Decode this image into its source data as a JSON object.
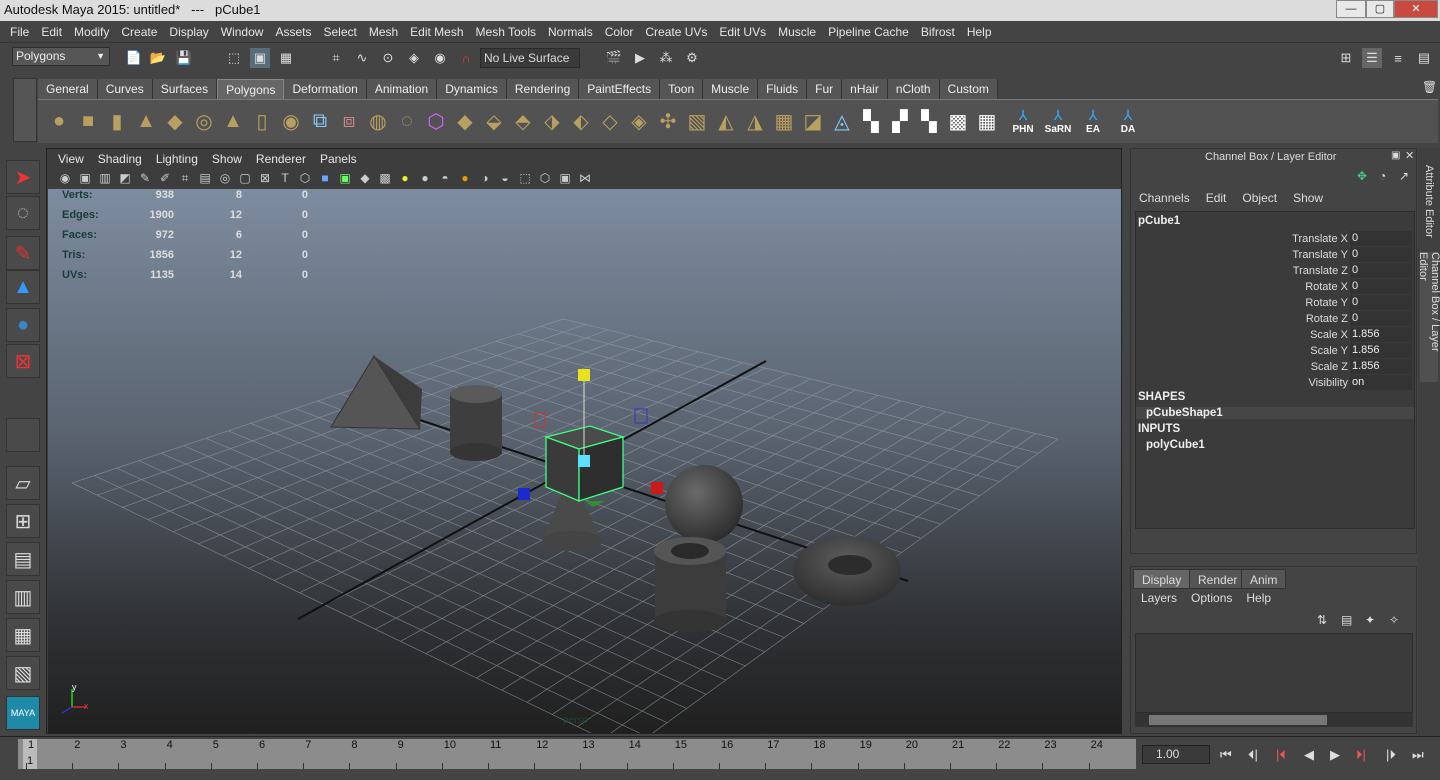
{
  "window": {
    "title": "Autodesk Maya 2015: untitled*   ---   pCube1",
    "controls": [
      "—",
      "▢",
      "✕"
    ]
  },
  "menubar": [
    "File",
    "Edit",
    "Modify",
    "Create",
    "Display",
    "Window",
    "Assets",
    "Select",
    "Mesh",
    "Edit Mesh",
    "Mesh Tools",
    "Normals",
    "Color",
    "Create UVs",
    "Edit UVs",
    "Muscle",
    "Pipeline Cache",
    "Bifrost",
    "Help"
  ],
  "status_line": {
    "mode": "Polygons",
    "live_surface": "No Live Surface"
  },
  "shelf": {
    "tabs": [
      "General",
      "Curves",
      "Surfaces",
      "Polygons",
      "Deformation",
      "Animation",
      "Dynamics",
      "Rendering",
      "PaintEffects",
      "Toon",
      "Muscle",
      "Fluids",
      "Fur",
      "nHair",
      "nCloth",
      "Custom"
    ],
    "active_tab": "Polygons",
    "text_icons": [
      "PHN",
      "SaRN",
      "EA",
      "DA"
    ]
  },
  "viewport": {
    "menu": [
      "View",
      "Shading",
      "Lighting",
      "Show",
      "Renderer",
      "Panels"
    ],
    "camera": "persp",
    "axis": {
      "y": "y",
      "x": "x"
    },
    "hud": [
      {
        "label": "Verts:",
        "a": "938",
        "b": "8",
        "c": "0"
      },
      {
        "label": "Edges:",
        "a": "1900",
        "b": "12",
        "c": "0"
      },
      {
        "label": "Faces:",
        "a": "972",
        "b": "6",
        "c": "0"
      },
      {
        "label": "Tris:",
        "a": "1856",
        "b": "12",
        "c": "0"
      },
      {
        "label": "UVs:",
        "a": "1135",
        "b": "14",
        "c": "0"
      }
    ]
  },
  "channel_box": {
    "title": "Channel Box / Layer Editor",
    "menu": [
      "Channels",
      "Edit",
      "Object",
      "Show"
    ],
    "object": "pCube1",
    "attributes": [
      {
        "name": "Translate X",
        "value": "0"
      },
      {
        "name": "Translate Y",
        "value": "0"
      },
      {
        "name": "Translate Z",
        "value": "0"
      },
      {
        "name": "Rotate X",
        "value": "0"
      },
      {
        "name": "Rotate Y",
        "value": "0"
      },
      {
        "name": "Rotate Z",
        "value": "0"
      },
      {
        "name": "Scale X",
        "value": "1.856"
      },
      {
        "name": "Scale Y",
        "value": "1.856"
      },
      {
        "name": "Scale Z",
        "value": "1.856"
      },
      {
        "name": "Visibility",
        "value": "on"
      }
    ],
    "shapes_label": "SHAPES",
    "shape": "pCubeShape1",
    "inputs_label": "INPUTS",
    "input": "polyCube1"
  },
  "side_tabs": [
    "Attribute Editor",
    "Channel Box / Layer Editor"
  ],
  "layer_editor": {
    "tabs": [
      "Display",
      "Render",
      "Anim"
    ],
    "active_tab": "Display",
    "menu": [
      "Layers",
      "Options",
      "Help"
    ]
  },
  "timeline": {
    "ticks": [
      "1",
      "2",
      "3",
      "4",
      "5",
      "6",
      "7",
      "8",
      "9",
      "10",
      "11",
      "12",
      "13",
      "14",
      "15",
      "16",
      "17",
      "18",
      "19",
      "20",
      "21",
      "22",
      "23",
      "24"
    ],
    "current_frame_marker": "1",
    "current_time": "1.00"
  }
}
